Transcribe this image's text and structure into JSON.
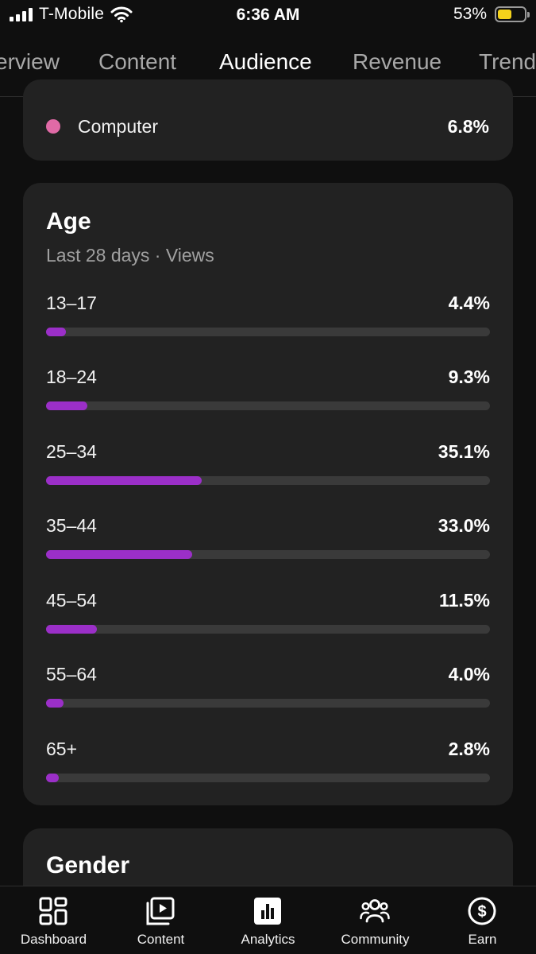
{
  "status_bar": {
    "carrier": "T-Mobile",
    "time": "6:36 AM",
    "battery_percent": "53%",
    "battery_level": 0.53,
    "battery_color": "#f4d21b"
  },
  "tabs": [
    {
      "label": "Overview",
      "visible_text": "erview"
    },
    {
      "label": "Content"
    },
    {
      "label": "Audience",
      "active": true
    },
    {
      "label": "Revenue"
    },
    {
      "label": "Trends",
      "visible_text": "Trend"
    }
  ],
  "device": {
    "label": "Computer",
    "value": "6.8%",
    "dot_color": "#e06aa6"
  },
  "age": {
    "title": "Age",
    "subtitle": "Last 28 days · Views",
    "bar_color": "#9b2fc8",
    "rows": [
      {
        "label": "13–17",
        "value": "4.4%",
        "percent": 4.4
      },
      {
        "label": "18–24",
        "value": "9.3%",
        "percent": 9.3
      },
      {
        "label": "25–34",
        "value": "35.1%",
        "percent": 35.1
      },
      {
        "label": "35–44",
        "value": "33.0%",
        "percent": 33.0
      },
      {
        "label": "45–54",
        "value": "11.5%",
        "percent": 11.5
      },
      {
        "label": "55–64",
        "value": "4.0%",
        "percent": 4.0
      },
      {
        "label": "65+",
        "value": "2.8%",
        "percent": 2.8
      }
    ]
  },
  "gender": {
    "title": "Gender"
  },
  "bottom_nav": [
    {
      "label": "Dashboard",
      "icon": "dashboard-icon"
    },
    {
      "label": "Content",
      "icon": "content-icon"
    },
    {
      "label": "Analytics",
      "icon": "analytics-icon",
      "active": true
    },
    {
      "label": "Community",
      "icon": "community-icon"
    },
    {
      "label": "Earn",
      "icon": "earn-icon"
    }
  ]
}
